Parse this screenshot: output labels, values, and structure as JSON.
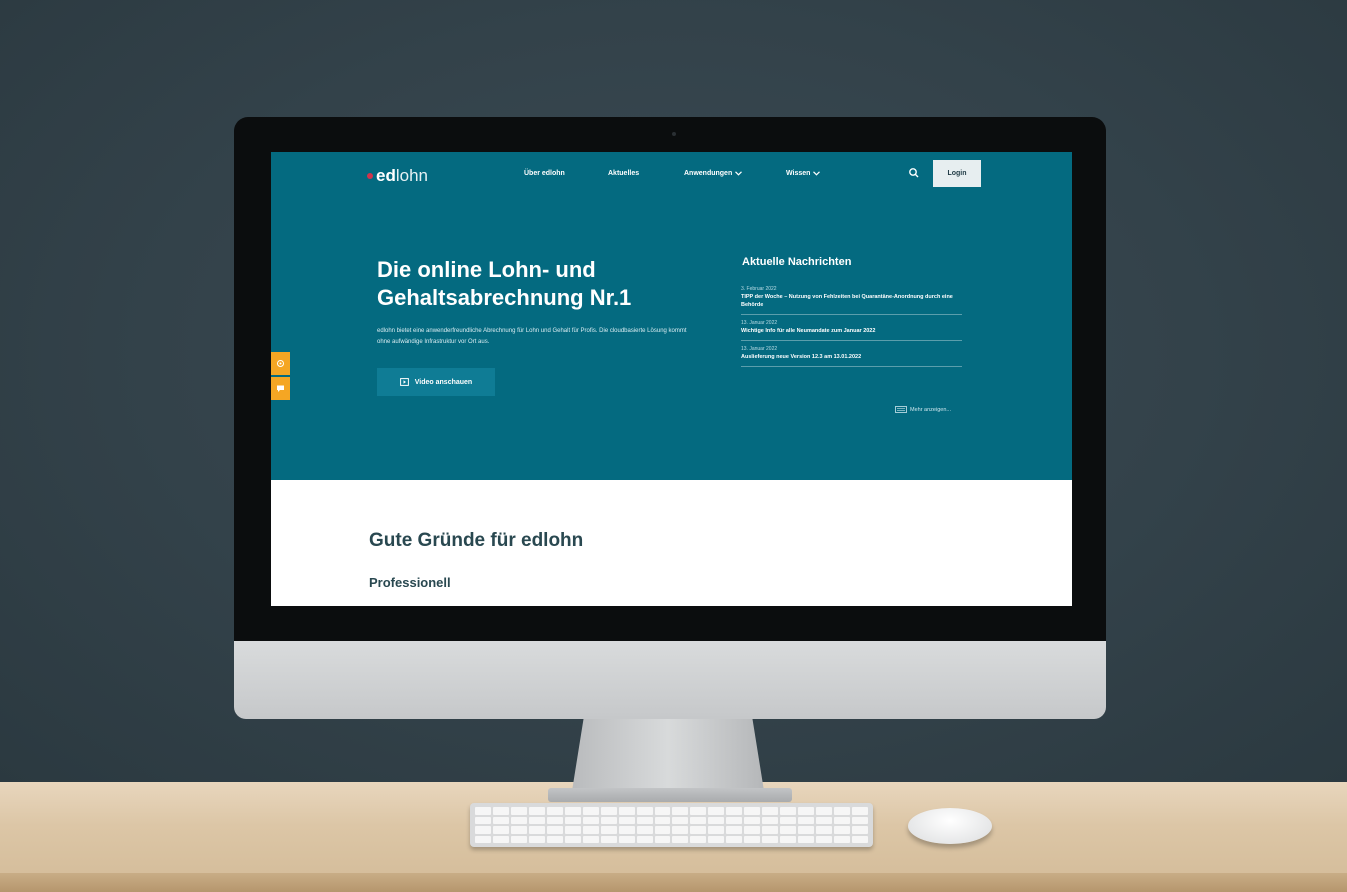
{
  "header": {
    "logo_prefix": "ed",
    "logo_suffix": "lohn",
    "nav": [
      {
        "label": "Über edlohn"
      },
      {
        "label": "Aktuelles"
      },
      {
        "label": "Anwendungen"
      },
      {
        "label": "Wissen"
      }
    ],
    "login_label": "Login"
  },
  "hero": {
    "title": "Die online Lohn- und Gehaltsabrechnung Nr.1",
    "description": "edlohn bietet eine anwenderfreundliche Abrechnung für Lohn und Gehalt für Profis. Die cloudbasierte Lösung kommt ohne aufwändige Infrastruktur vor Ort aus.",
    "video_button_label": "Video anschauen"
  },
  "news": {
    "title": "Aktuelle Nachrichten",
    "items": [
      {
        "date": "3. Februar 2022",
        "text": "TIPP der Woche – Nutzung von Fehlzeiten bei Quarantäne-Anordnung durch eine Behörde"
      },
      {
        "date": "13. Januar 2022",
        "text": "Wichtige Info für alle Neumandate zum Januar 2022"
      },
      {
        "date": "13. Januar 2022",
        "text": "Auslieferung neue Version 12.3 am 13.01.2022"
      }
    ],
    "more_label": "Mehr anzeigen..."
  },
  "section": {
    "title": "Gute Gründe für edlohn",
    "subtitle": "Professionell"
  },
  "colors": {
    "hero_bg": "#046a80",
    "accent_orange": "#f5a623",
    "logo_red": "#d2334c",
    "heading": "#294850"
  },
  "icons": {
    "search": "search-icon",
    "video": "video-icon",
    "chevron": "chevron-down-icon",
    "newspaper": "newspaper-icon",
    "side_widget": [
      "settings-icon",
      "chat-icon"
    ]
  }
}
